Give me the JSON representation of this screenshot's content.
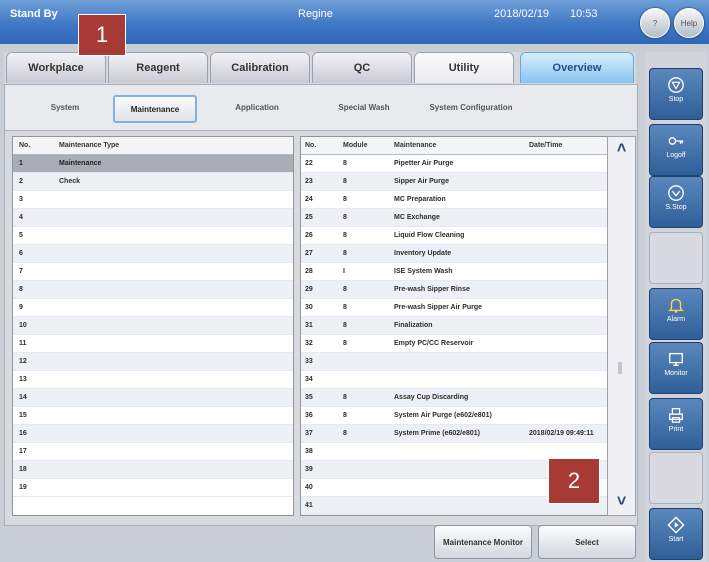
{
  "header": {
    "status": "Stand By",
    "user": "Regine",
    "date": "2018/02/19",
    "time": "10:53",
    "help_icon_label": "?",
    "help_label": "Help"
  },
  "callouts": {
    "one": "1",
    "two": "2"
  },
  "main_tabs": [
    "Workplace",
    "Reagent",
    "Calibration",
    "QC",
    "Utility",
    "Overview"
  ],
  "sub_tabs": [
    "System",
    "Maintenance",
    "Application",
    "Special Wash",
    "System Configuration"
  ],
  "type_table": {
    "headers": [
      "No.",
      "Maintenance Type"
    ],
    "rows": [
      [
        "1",
        "Maintenance"
      ],
      [
        "2",
        "Check"
      ],
      [
        "3",
        ""
      ],
      [
        "4",
        ""
      ],
      [
        "5",
        ""
      ],
      [
        "6",
        ""
      ],
      [
        "7",
        ""
      ],
      [
        "8",
        ""
      ],
      [
        "9",
        ""
      ],
      [
        "10",
        ""
      ],
      [
        "11",
        ""
      ],
      [
        "12",
        ""
      ],
      [
        "13",
        ""
      ],
      [
        "14",
        ""
      ],
      [
        "15",
        ""
      ],
      [
        "16",
        ""
      ],
      [
        "17",
        ""
      ],
      [
        "18",
        ""
      ],
      [
        "19",
        ""
      ]
    ]
  },
  "maint_table": {
    "headers": [
      "No.",
      "Module",
      "Maintenance",
      "Date/Time"
    ],
    "rows": [
      [
        "22",
        "8",
        "Pipetter Air Purge",
        ""
      ],
      [
        "23",
        "8",
        "Sipper Air Purge",
        ""
      ],
      [
        "24",
        "8",
        "MC Preparation",
        ""
      ],
      [
        "25",
        "8",
        "MC Exchange",
        ""
      ],
      [
        "26",
        "8",
        "Liquid Flow Cleaning",
        ""
      ],
      [
        "27",
        "8",
        "Inventory Update",
        ""
      ],
      [
        "28",
        "I",
        "ISE System Wash",
        ""
      ],
      [
        "29",
        "8",
        "Pre-wash Sipper Rinse",
        ""
      ],
      [
        "30",
        "8",
        "Pre-wash Sipper Air Purge",
        ""
      ],
      [
        "31",
        "8",
        "Finalization",
        ""
      ],
      [
        "32",
        "8",
        "Empty PC/CC Reservoir",
        ""
      ],
      [
        "33",
        "",
        "",
        ""
      ],
      [
        "34",
        "",
        "",
        ""
      ],
      [
        "35",
        "8",
        "Assay Cup Discarding",
        ""
      ],
      [
        "36",
        "8",
        "System Air Purge (e602/e801)",
        ""
      ],
      [
        "37",
        "8",
        "System Prime (e602/e801)",
        "2018/02/19 09:49:11"
      ],
      [
        "38",
        "",
        "",
        ""
      ],
      [
        "39",
        "",
        "",
        ""
      ],
      [
        "40",
        "",
        "",
        ""
      ],
      [
        "41",
        "",
        "",
        ""
      ]
    ]
  },
  "buttons": {
    "monitor": "Maintenance Monitor",
    "select": "Select"
  },
  "sidebar": [
    "Stop",
    "Logoff",
    "S.Stop",
    "",
    "Alarm",
    "Monitor",
    "Print",
    "",
    "Start"
  ],
  "colors": {
    "header": "#3e78c5",
    "accent": "#a83a35",
    "sidebar_button": "#2f5f99"
  }
}
